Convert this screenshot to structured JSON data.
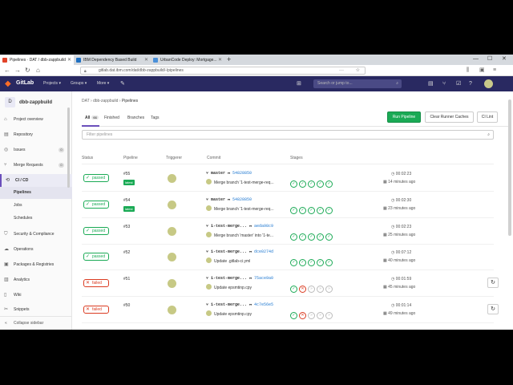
{
  "browser": {
    "tabs": [
      {
        "title": "Pipelines · DAT / dbb-zappbuild",
        "active": true,
        "color": "#e24329"
      },
      {
        "title": "IBM Dependency Based Build",
        "active": false,
        "color": "#1f70c1"
      },
      {
        "title": "UrbanCode Deploy: Mortgage...",
        "active": false,
        "color": "#4a90d9"
      }
    ],
    "new_tab": "+",
    "url": "gitlab.dat.ibm.com/dat/dbb-zappbuild/-/pipelines",
    "win_min": "—",
    "win_max": "☐",
    "win_close": "✕"
  },
  "gitlab": {
    "brand": "GitLab",
    "nav": [
      "Projects ▾",
      "Groups ▾",
      "More ▾"
    ],
    "search_placeholder": "Search or jump to..."
  },
  "sidebar": {
    "project_initial": "D",
    "project_name": "dbb-zappbuild",
    "items": [
      {
        "label": "Project overview",
        "icon": "home-icon",
        "glyph": "⌂"
      },
      {
        "label": "Repository",
        "icon": "book-icon",
        "glyph": "▤"
      },
      {
        "label": "Issues",
        "icon": "issues-icon",
        "glyph": "◎",
        "count": "0"
      },
      {
        "label": "Merge Requests",
        "icon": "merge-icon",
        "glyph": "⑂",
        "count": "0"
      },
      {
        "label": "CI / CD",
        "icon": "rocket-icon",
        "glyph": "⟲",
        "active": true
      },
      {
        "label": "Security & Compliance",
        "icon": "shield-icon",
        "glyph": "⛉"
      },
      {
        "label": "Operations",
        "icon": "cloud-icon",
        "glyph": "☁"
      },
      {
        "label": "Packages & Registries",
        "icon": "package-icon",
        "glyph": "▣"
      },
      {
        "label": "Analytics",
        "icon": "chart-icon",
        "glyph": "▥"
      },
      {
        "label": "Wiki",
        "icon": "wiki-icon",
        "glyph": "▯"
      },
      {
        "label": "Snippets",
        "icon": "scissors-icon",
        "glyph": "✂"
      }
    ],
    "subitems": [
      {
        "label": "Pipelines",
        "active": true
      },
      {
        "label": "Jobs",
        "active": false
      },
      {
        "label": "Schedules",
        "active": false
      }
    ],
    "collapse": "Collapse sidebar"
  },
  "breadcrumb": {
    "group": "DAT",
    "project": "dbb-zappbuild",
    "current": "Pipelines"
  },
  "tabs": [
    {
      "label": "All",
      "badge": "66",
      "active": true
    },
    {
      "label": "Finished",
      "active": false
    },
    {
      "label": "Branches",
      "active": false
    },
    {
      "label": "Tags",
      "active": false
    }
  ],
  "buttons": {
    "run_pipeline": "Run Pipeline",
    "clear_caches": "Clear Runner Caches",
    "ci_lint": "CI Lint"
  },
  "filter_placeholder": "Filter pipelines",
  "columns": {
    "status": "Status",
    "pipeline": "Pipeline",
    "triggerer": "Triggerer",
    "commit": "Commit",
    "stages": "Stages"
  },
  "pipelines": [
    {
      "status": "passed",
      "id": "#55",
      "latest": "latest",
      "branch": "master",
      "sha": "54828850",
      "message": "Merge branch '1-test-merge-req...",
      "stages": [
        "success",
        "success",
        "success",
        "success",
        "success"
      ],
      "duration": "00:02:23",
      "ago": "14 minutes ago",
      "retry": false
    },
    {
      "status": "passed",
      "id": "#54",
      "latest": "latest",
      "branch": "master",
      "sha": "54828850",
      "message": "Merge branch '1-test-merge-req...",
      "stages": [
        "success",
        "success",
        "success",
        "success",
        "success"
      ],
      "duration": "00:02:30",
      "ago": "23 minutes ago",
      "retry": false
    },
    {
      "status": "passed",
      "id": "#53",
      "latest": "",
      "branch": "1-test-merge...",
      "sha": "aeda98c9",
      "message": "Merge branch 'master' into '1-te...",
      "stages": [
        "success",
        "success",
        "success",
        "success",
        "success"
      ],
      "duration": "00:02:23",
      "ago": "25 minutes ago",
      "retry": false
    },
    {
      "status": "passed",
      "id": "#52",
      "latest": "",
      "branch": "1-test-merge...",
      "sha": "dce0274d",
      "message": "Update .gitlab-ci.yml",
      "stages": [
        "success",
        "success",
        "success",
        "success",
        "success"
      ],
      "duration": "00:07:12",
      "ago": "40 minutes ago",
      "retry": false
    },
    {
      "status": "failed",
      "id": "#51",
      "latest": "",
      "branch": "1-test-merge...",
      "sha": "75ace9a0",
      "message": "Update epsmtinp.cpy",
      "stages": [
        "success",
        "failed",
        "skipped",
        "skipped",
        "skipped"
      ],
      "duration": "00:01:59",
      "ago": "45 minutes ago",
      "retry": true
    },
    {
      "status": "failed",
      "id": "#50",
      "latest": "",
      "branch": "1-test-merge...",
      "sha": "4c7e56e5",
      "message": "Update epsmtinp.cpy",
      "stages": [
        "success",
        "failed",
        "skipped",
        "skipped",
        "skipped"
      ],
      "duration": "00:01:14",
      "ago": "49 minutes ago",
      "retry": true
    }
  ]
}
